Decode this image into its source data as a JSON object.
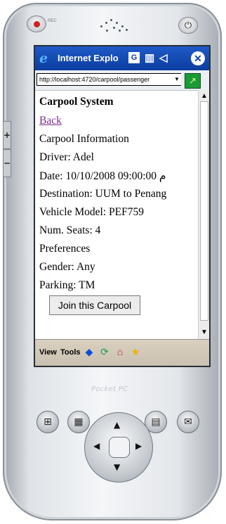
{
  "device": {
    "top_label": "REC",
    "brand_label": "Pocket PC",
    "side_keys": [
      "+",
      "−"
    ]
  },
  "browser": {
    "title": "Internet Explo",
    "address": "http://localhost:4720/carpool/passenger"
  },
  "page": {
    "site_title": "Carpool System",
    "back_link": "Back",
    "section_title": "Carpool Information",
    "driver": "Driver: Adel",
    "date": "Date: 10/10/2008 09:00:00 م",
    "destination": "Destination: UUM to Penang",
    "vehicle": "Vehicle Model: PEF759",
    "seats": "Num. Seats: 4",
    "preferences": "Preferences",
    "gender": "Gender: Any",
    "parking": "Parking: TM",
    "join_button": "Join this Carpool"
  },
  "menu": {
    "view": "View",
    "tools": "Tools"
  },
  "icons": {
    "ie": "ie-icon",
    "g": "G",
    "close": "✕",
    "signal": "signal-icon",
    "volume": "volume-icon",
    "go": "go-arrow-icon",
    "back": "back-icon",
    "refresh": "refresh-icon",
    "home": "home-icon",
    "favorites": "favorites-icon",
    "start": "windows-icon",
    "calendar": "calendar-icon",
    "contacts": "contacts-icon",
    "mail": "mail-icon"
  },
  "colors": {
    "titlebar": "#0b3e9f",
    "link_visited": "#7b2b8f",
    "menubar": "#d9d0c0"
  }
}
